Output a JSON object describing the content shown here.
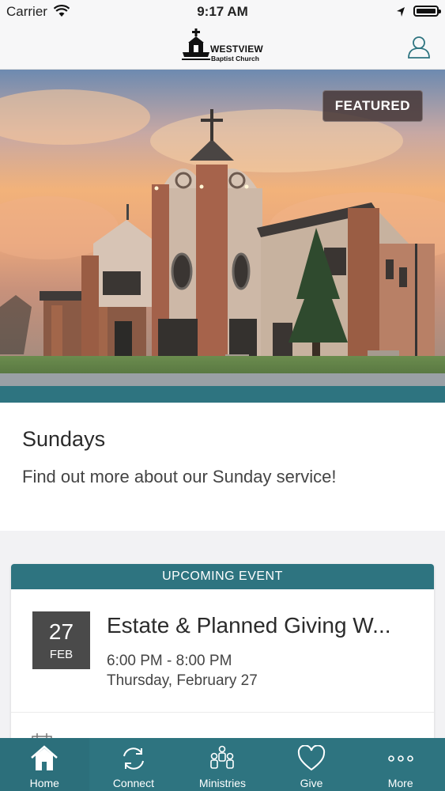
{
  "status_bar": {
    "carrier": "Carrier",
    "time": "9:17 AM"
  },
  "header": {
    "logo_line1": "WESTVIEW",
    "logo_line2": "Baptist Church",
    "profile_icon": "person-icon"
  },
  "hero": {
    "badge": "FEATURED"
  },
  "featured": {
    "title": "Sundays",
    "description": "Find out more about our Sunday service!"
  },
  "event": {
    "header": "UPCOMING EVENT",
    "day": "27",
    "month": "FEB",
    "title": "Estate & Planned Giving W...",
    "time": "6:00 PM - 8:00 PM",
    "date": "Thursday, February 27"
  },
  "tabs": [
    {
      "label": "Home",
      "icon": "home-icon"
    },
    {
      "label": "Connect",
      "icon": "connect-icon"
    },
    {
      "label": "Ministries",
      "icon": "people-icon"
    },
    {
      "label": "Give",
      "icon": "heart-icon"
    },
    {
      "label": "More",
      "icon": "more-icon"
    }
  ],
  "colors": {
    "accent": "#2e7480",
    "date_box": "#4a4a4a"
  }
}
